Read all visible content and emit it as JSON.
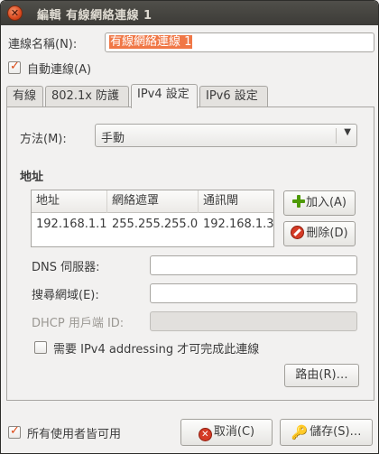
{
  "window": {
    "title": "編輯 有線網絡連線 1"
  },
  "connection_name": {
    "label": "連線名稱(N):",
    "value": "有線網絡連線 1"
  },
  "auto_connect": {
    "label": "自動連線(A)",
    "checked": true
  },
  "tabs": [
    {
      "label": "有線",
      "active": false
    },
    {
      "label": "802.1x 防護",
      "active": false
    },
    {
      "label": "IPv4 設定",
      "active": true
    },
    {
      "label": "IPv6 設定",
      "active": false
    }
  ],
  "method": {
    "label": "方法(M):",
    "value": "手動"
  },
  "addresses": {
    "section_title": "地址",
    "columns": [
      "地址",
      "網絡遮罩",
      "通訊閘"
    ],
    "rows": [
      [
        "192.168.1.1",
        "255.255.255.0",
        "192.168.1.3"
      ]
    ],
    "add_label": "加入(A)",
    "delete_label": "刪除(D)"
  },
  "dns": {
    "label": "DNS 伺服器:",
    "value": ""
  },
  "search_domains": {
    "label": "搜尋網域(E):",
    "value": ""
  },
  "dhcp_client_id": {
    "label": "DHCP 用戶端 ID:",
    "value": ""
  },
  "require_ipv4": {
    "label": "需要 IPv4 addressing 才可完成此連線",
    "checked": false
  },
  "routes_button": "路由(R)…",
  "all_users": {
    "label": "所有使用者皆可用",
    "checked": true
  },
  "cancel_button": "取消(C)",
  "save_button": "儲存(S)…",
  "colors": {
    "accent": "#dd4814",
    "selection": "#f07746",
    "titlebar": "#3c3b37"
  }
}
